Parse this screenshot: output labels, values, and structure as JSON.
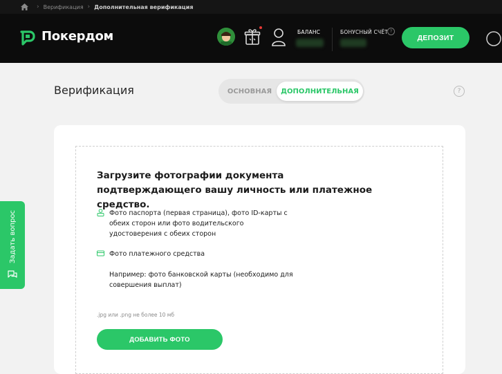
{
  "breadcrumb": {
    "items": [
      "Верификация",
      "Дополнительная верификация"
    ]
  },
  "header": {
    "brand": "Покердом",
    "balance_label": "БАЛАНС",
    "bonus_label": "БОНУСНЫЙ СЧЁТ",
    "deposit_label": "ДЕПОЗИТ",
    "icons": [
      "home-icon",
      "logo-icon",
      "promo-avatar-icon",
      "gift-icon",
      "user-icon",
      "info-icon",
      "menu-icon"
    ]
  },
  "page": {
    "title": "Верификация",
    "tabs": [
      "ОСНОВНАЯ",
      "ДОПОЛНИТЕЛЬНАЯ"
    ],
    "active_tab": "ДОПОЛНИТЕЛЬНАЯ"
  },
  "upload": {
    "title": "Загрузите фотографии документа подтверждающего вашу личность или платежное средство.",
    "items": [
      {
        "icon": "person-icon",
        "text": "Фото паспорта (первая страница), фото ID-карты с обеих сторон или фото водительского удостоверения с обеих сторон"
      },
      {
        "icon": "card-icon",
        "text": "Фото платежного средства"
      }
    ],
    "example": "Например: фото банковской карты (необходимо для совершения выплат)",
    "file_hint": ".jpg или .png не более 10 мб",
    "button_label": "ДОБАВИТЬ ФОТО"
  },
  "support": {
    "label": "Задать вопрос"
  },
  "colors": {
    "accent": "#2bc768",
    "header_bg": "#0c0c0c",
    "page_bg": "#f2f2f2"
  }
}
